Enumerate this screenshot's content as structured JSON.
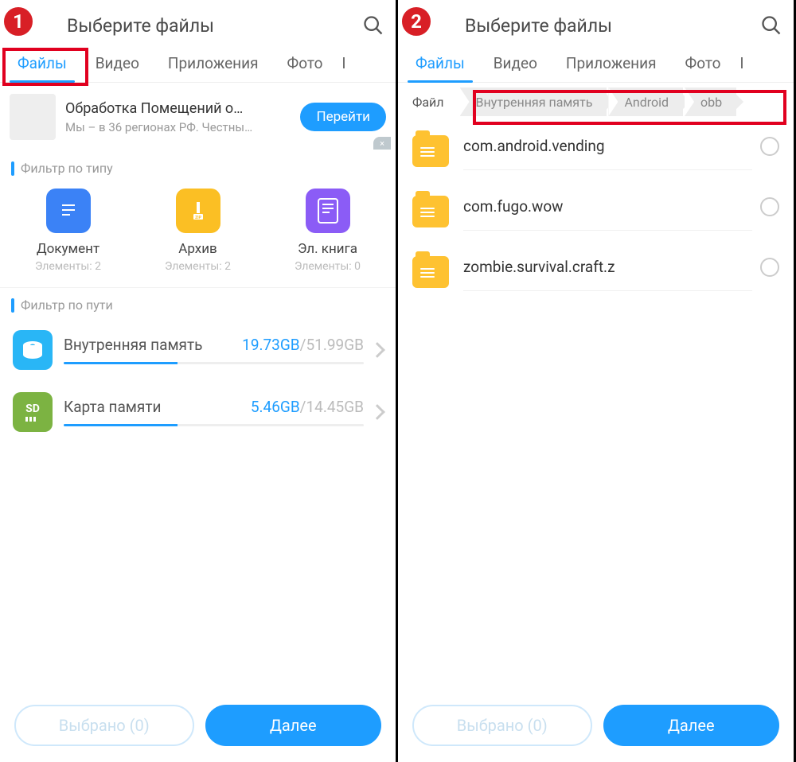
{
  "left": {
    "badge": "1",
    "title": "Выберите файлы",
    "tabs": [
      "Файлы",
      "Видео",
      "Приложения",
      "Фото"
    ],
    "ad": {
      "title": "Обработка Помещений о…",
      "sub": "Мы – в 36 регионах РФ. Честны…",
      "cta": "Перейти"
    },
    "filter_type_label": "Фильтр по типу",
    "types": [
      {
        "label": "Документ",
        "sub": "Элементы: 2",
        "color": "#3b82f6"
      },
      {
        "label": "Архив",
        "sub": "Элементы: 2",
        "color": "#fbbf24"
      },
      {
        "label": "Эл. книга",
        "sub": "Элементы: 0",
        "color": "#8b5cf6"
      }
    ],
    "filter_path_label": "Фильтр по пути",
    "storage": [
      {
        "name": "Внутренняя память",
        "used": "19.73GB",
        "total": "/51.99GB",
        "pct": 38,
        "kind": "disk"
      },
      {
        "name": "Карта памяти",
        "used": "5.46GB",
        "total": "/14.45GB",
        "pct": 38,
        "kind": "sd"
      }
    ],
    "selected": "Выбрано (0)",
    "next": "Далее"
  },
  "right": {
    "badge": "2",
    "title": "Выберите файлы",
    "tabs": [
      "Файлы",
      "Видео",
      "Приложения",
      "Фото"
    ],
    "crumbs": [
      "Файл",
      "Внутренняя память",
      "Android",
      "obb"
    ],
    "folders": [
      "com.android.vending",
      "com.fugo.wow",
      "zombie.survival.craft.z"
    ],
    "selected": "Выбрано (0)",
    "next": "Далее"
  }
}
